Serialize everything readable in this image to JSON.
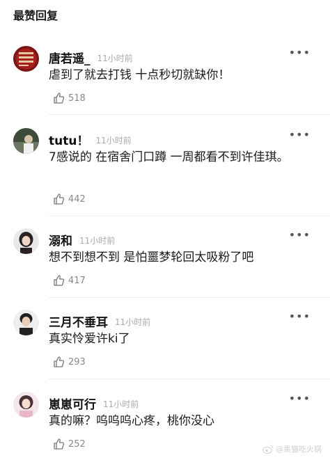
{
  "section_title": "最赞回复",
  "comments": [
    {
      "username": "唐若遥_",
      "time": "11小时前",
      "text": "虐到了就去打钱 十点秒切就缺你！",
      "likes": "518"
    },
    {
      "username": "tutu！",
      "time": "11小时前",
      "text": "7感说的 在宿舍门口蹲 一周都看不到许佳琪。",
      "likes": "442"
    },
    {
      "username": "溺和",
      "time": "11小时前",
      "text": "想不到想不到 是怕噩梦轮回太吸粉了吧",
      "likes": "417"
    },
    {
      "username": "三月不垂耳",
      "time": "11小时前",
      "text": "真实怜爱许ki了",
      "likes": "293"
    },
    {
      "username": "崽崽可行",
      "time": "11小时前",
      "text": "真的嘛？呜呜呜心疼，桃你没心",
      "likes": "252"
    }
  ],
  "more_icon": "•••",
  "watermark": "@黑猫吃火锅",
  "colors": {
    "time": "#aaaaaa",
    "like": "#888888"
  }
}
